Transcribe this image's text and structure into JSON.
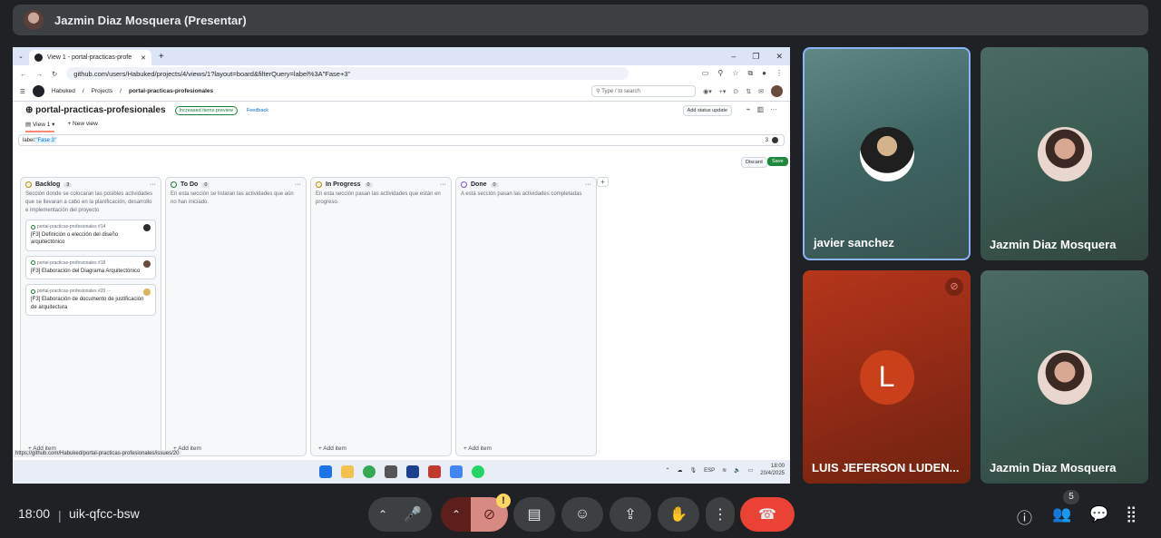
{
  "meet": {
    "presenter_name": "Jazmin Diaz Mosquera (Presentar)",
    "time": "18:00",
    "meeting_code": "uik-qfcc-bsw",
    "participants_count": "5",
    "participants": [
      {
        "name": "javier sanchez"
      },
      {
        "name": "Jazmin Diaz Mosquera"
      },
      {
        "name": "LUIS JEFERSON LUDEN...",
        "initial": "L"
      },
      {
        "name": "Jazmin Diaz Mosquera"
      }
    ],
    "warning_badge": "!"
  },
  "browser": {
    "tab_title": "View 1 - portal-practicas-profe",
    "url": "github.com/users/Habuked/projects/4/views/1?layout=board&filterQuery=label%3A\"Fase+3\"",
    "status_url": "https://github.com/Habuked/portal-practicas-profesionales/issues/20"
  },
  "github": {
    "breadcrumbs": [
      "Habuked",
      "Projects",
      "portal-practicas-profesionales"
    ],
    "search_placeholder": "Type / to search",
    "project_title": "portal-practicas-profesionales",
    "preview_badge": "Increased items preview",
    "feedback": "Feedback",
    "status_update": "Add status update",
    "view_tab": "View 1",
    "new_view": "+ New view",
    "filter_prefix": "label:",
    "filter_value": "\"Fase 3\"",
    "filter_count": "3",
    "discard": "Discard",
    "save": "Save",
    "columns": [
      {
        "title": "Backlog",
        "count": "3",
        "color": "#bf8700",
        "desc": "Sección donde se colocaran las posibles actividades que se llevaran a cabo en la planificación, desarrollo e implementación del proyecto",
        "add_item": "+ Add item"
      },
      {
        "title": "To Do",
        "count": "0",
        "color": "#1a7f37",
        "desc": "En esta sección se listaran las actividades que aún no han iniciado.",
        "add_item": "+ Add item"
      },
      {
        "title": "In Progress",
        "count": "0",
        "color": "#bf8700",
        "desc": "En esta sección pasan las actividades que están en progreso.",
        "add_item": "+ Add item"
      },
      {
        "title": "Done",
        "count": "0",
        "color": "#8250df",
        "desc": "A está sección pasan las actividades completadas",
        "add_item": "+ Add item"
      }
    ],
    "cards": [
      {
        "ref": "portal-practicas-profesionales #14",
        "title": "[F3] Definición o elección del diseño arquitectónico"
      },
      {
        "ref": "portal-practicas-profesionales #18",
        "title": "[F3] Elaboración del Diagrama Arquitectónico"
      },
      {
        "ref": "portal-practicas-profesionales #20 ···",
        "title": "[F3] Elaboración de documento de justificación de arquitectura"
      }
    ]
  },
  "taskbar": {
    "lang": "ESP",
    "time": "18:00",
    "date": "20/4/2025"
  }
}
